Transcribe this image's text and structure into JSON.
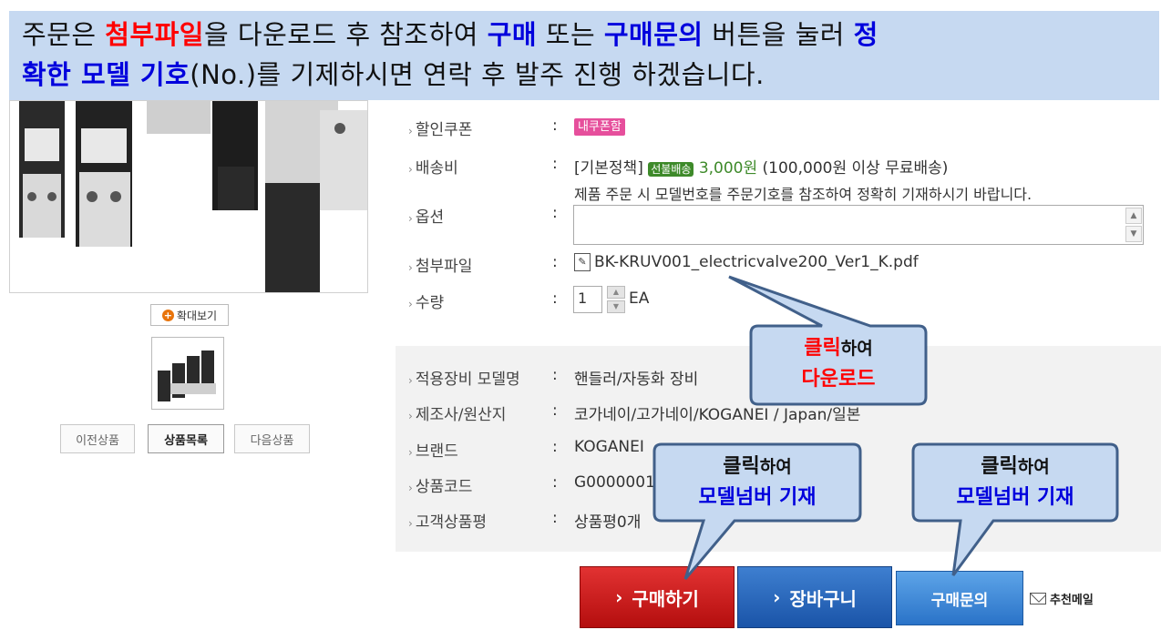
{
  "banner": {
    "line1": [
      {
        "text": "주문은 ",
        "style": "plain"
      },
      {
        "text": "첨부파일",
        "style": "red"
      },
      {
        "text": "을 다운로드 후 참조하여 ",
        "style": "plain"
      },
      {
        "text": "구매",
        "style": "blue"
      },
      {
        "text": " 또는 ",
        "style": "plain"
      },
      {
        "text": "구매문의",
        "style": "blue"
      },
      {
        "text": " 버튼을 눌러 ",
        "style": "plain"
      },
      {
        "text": "정",
        "style": "blue"
      }
    ],
    "line2": [
      {
        "text": "확한 모델 기호",
        "style": "blue"
      },
      {
        "text": "(No.)를 기제하시면 연락 후 발주 진행 하겠습니다.",
        "style": "plain"
      }
    ]
  },
  "left_panel": {
    "zoom_label": "확대보기",
    "prev_label": "이전상품",
    "list_label": "상품목록",
    "next_label": "다음상품"
  },
  "info": {
    "coupon_label": "할인쿠폰",
    "coupon_badge": "내쿠폰함",
    "shipping_label": "배송비",
    "shipping_policy": "[기본정책]",
    "shipping_badge": "선불배송",
    "shipping_price": "3,000원",
    "shipping_note": "(100,000원 이상 무료배송)",
    "option_notice": "제품 주문 시 모델번호를 주문기호를 참조하여 정확히 기재하시기 바랍니다.",
    "option_label": "옵션",
    "attach_label": "첨부파일",
    "attach_file": "BK-KRUV001_electricvalve200_Ver1_K.pdf",
    "qty_label": "수량",
    "qty_value": "1",
    "qty_unit": "EA",
    "colon": ":"
  },
  "specs": {
    "model_label": "적용장비 모델명",
    "model_value": "핸들러/자동화 장비",
    "maker_label": "제조사/원산지",
    "maker_value": "코가네이/고가네이/KOGANEI / Japan/일본",
    "brand_label": "브랜드",
    "brand_value": "KOGANEI",
    "code_label": "상품코드",
    "code_value": "G00000018",
    "review_label": "고객상품평",
    "review_value": "상품평0개"
  },
  "buttons": {
    "buy": "구매하기",
    "cart": "장바구니",
    "inquiry": "구매문의",
    "mail": "추천메일",
    "arrow": "›"
  },
  "callouts": {
    "download_line1_red": "클릭",
    "download_line1_rest": "하여",
    "download_line2": "다운로드",
    "buy_line1_bold": "클릭",
    "buy_line1_rest": "하여",
    "buy_line2": "모델넘버 기재",
    "inquiry_line1_bold": "클릭",
    "inquiry_line1_rest": "하여",
    "inquiry_line2": "모델넘버 기재"
  },
  "colors": {
    "banner_bg": "#c6d9f1",
    "callout_bg": "#c6d9f1",
    "callout_border": "#41608a",
    "highlight_red": "#ff0000",
    "highlight_blue": "#0000dd",
    "buy_red": "#c51818",
    "cart_blue": "#2a64b8"
  }
}
